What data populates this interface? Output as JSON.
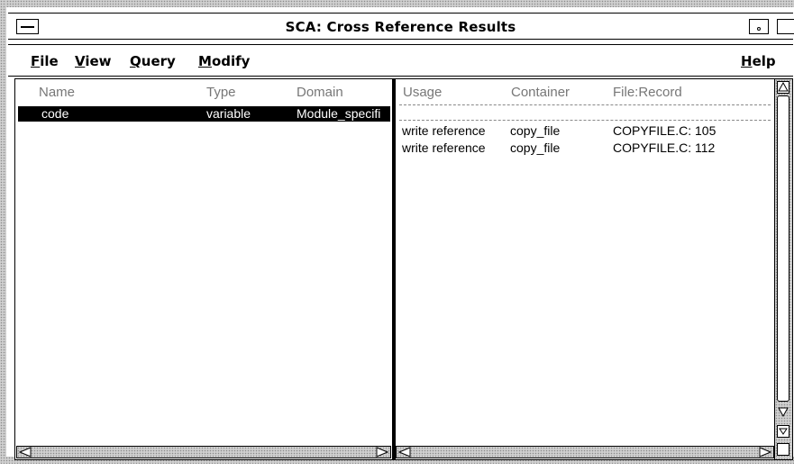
{
  "window": {
    "title": "SCA: Cross Reference Results"
  },
  "menubar": {
    "file": {
      "mnemonic": "F",
      "rest": "ile"
    },
    "view": {
      "mnemonic": "V",
      "rest": "iew"
    },
    "query": {
      "mnemonic": "Q",
      "rest": "uery"
    },
    "modify": {
      "mnemonic": "M",
      "rest": "odify"
    },
    "help": {
      "mnemonic": "H",
      "rest": "elp"
    }
  },
  "left_pane": {
    "columns": [
      "Name",
      "Type",
      "Domain"
    ],
    "rows": [
      {
        "name": "code",
        "type": "variable",
        "domain": "Module_specifi",
        "selected": true
      }
    ]
  },
  "right_pane": {
    "columns": [
      "Usage",
      "Container",
      "File:Record"
    ],
    "rows": [
      {
        "usage": "write reference",
        "container": "copy_file",
        "file_record": "COPYFILE.C: 105"
      },
      {
        "usage": "write reference",
        "container": "copy_file",
        "file_record": "COPYFILE.C: 112"
      }
    ]
  },
  "icons": {
    "window_menu": "window-menu-icon",
    "minimize": "minimize-icon",
    "maximize": "maximize-icon",
    "expand": "tree-expand-icon"
  },
  "colors": {
    "selection_bg": "#000000",
    "header_text": "#777777",
    "frame": "#cfcfcf"
  }
}
